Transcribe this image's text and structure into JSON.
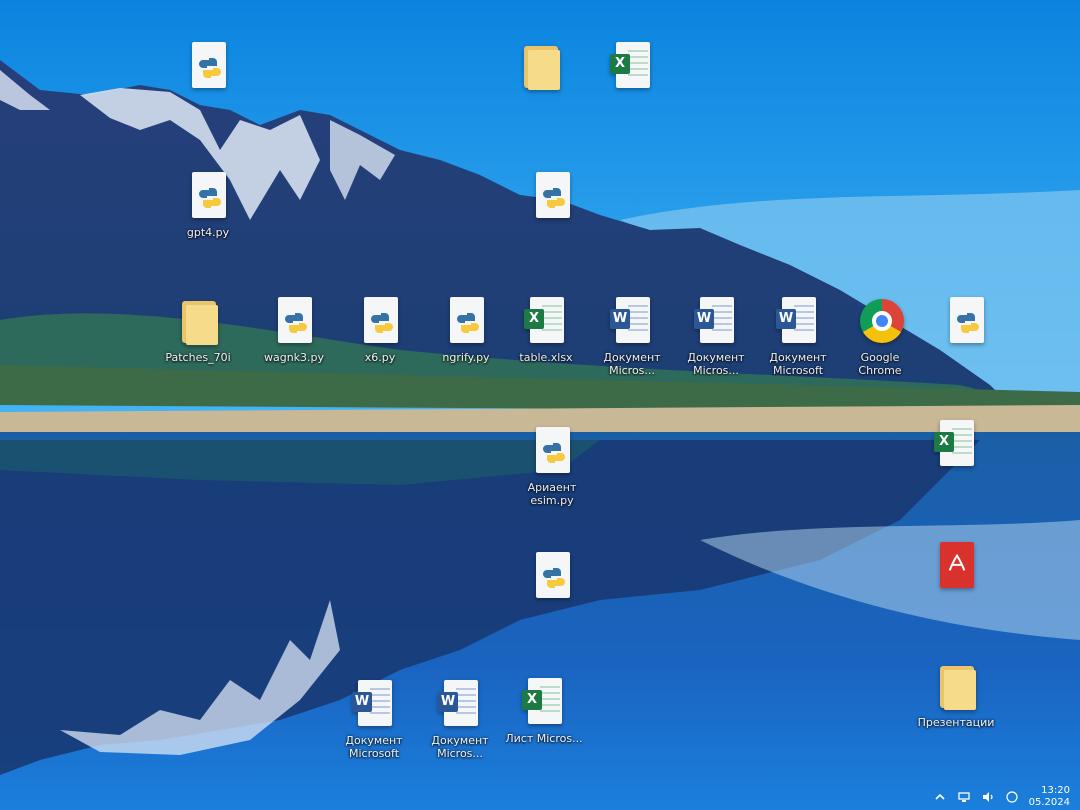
{
  "desktop": {
    "icons_row1": [
      {
        "type": "python",
        "label": ""
      },
      {
        "type": "folder",
        "label": ""
      },
      {
        "type": "excel",
        "label": ""
      }
    ],
    "icons_row2": [
      {
        "type": "python",
        "label": "gpt4.py"
      },
      {
        "type": "python",
        "label": ""
      }
    ],
    "icons_row3": [
      {
        "type": "folder",
        "label": "Patches_70i"
      },
      {
        "type": "python",
        "label": "wagnk3.py"
      },
      {
        "type": "python",
        "label": "x6.py"
      },
      {
        "type": "python",
        "label": "ngrify.py"
      },
      {
        "type": "excel",
        "label": "table.xlsx"
      },
      {
        "type": "word",
        "label": "Документ Micros..."
      },
      {
        "type": "word",
        "label": "Документ Micros..."
      },
      {
        "type": "word",
        "label": "Документ Microsoft"
      },
      {
        "type": "chrome",
        "label": "Google Chrome"
      },
      {
        "type": "python",
        "label": ""
      }
    ],
    "icons_col_mid": [
      {
        "type": "python",
        "label": "Ариаент esim.py"
      },
      {
        "type": "python",
        "label": ""
      }
    ],
    "icons_bottom": [
      {
        "type": "word",
        "label": "Документ Microsoft"
      },
      {
        "type": "word",
        "label": "Документ Micros..."
      },
      {
        "type": "excel",
        "label": "Лист Micros..."
      }
    ],
    "icons_right": [
      {
        "type": "excel",
        "label": ""
      },
      {
        "type": "pdf",
        "label": ""
      },
      {
        "type": "folder",
        "label": "Презентации"
      }
    ]
  },
  "tray": {
    "time": "13:20",
    "date": "05.2024"
  }
}
